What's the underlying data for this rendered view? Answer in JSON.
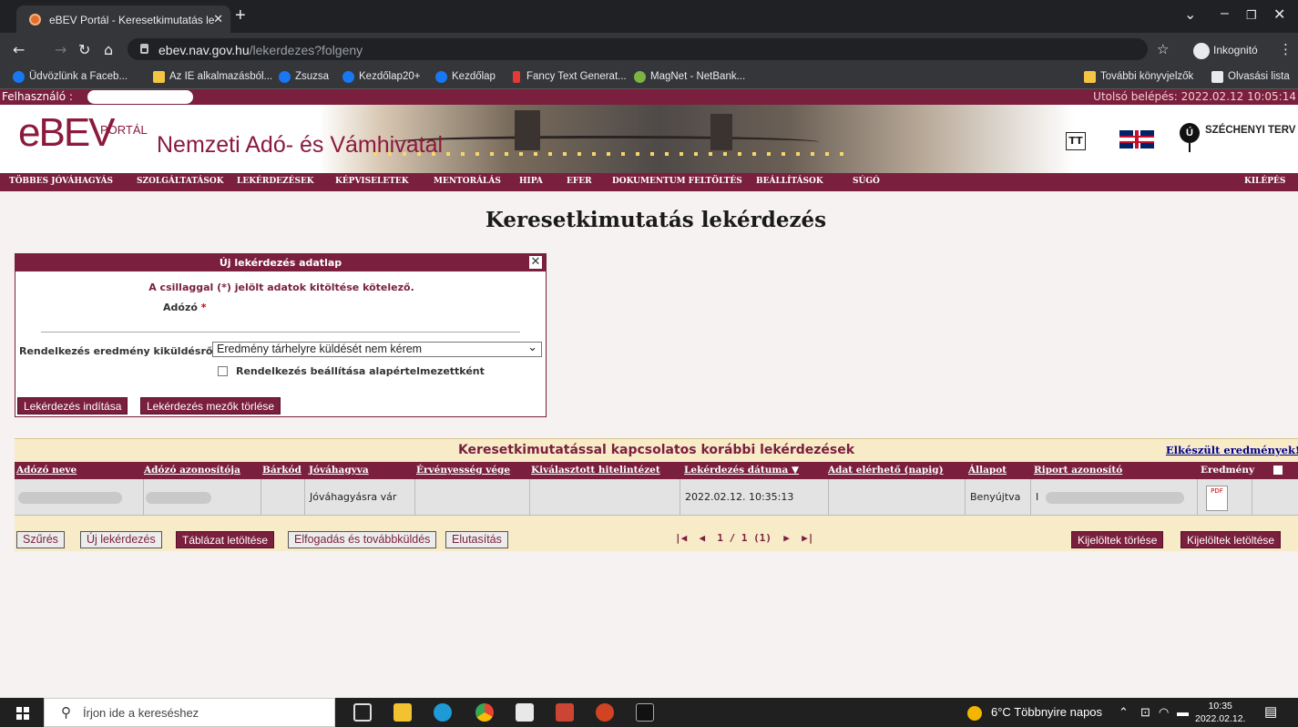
{
  "browser": {
    "tab_title": "eBEV Portál - Keresetkimutatás le",
    "url_host": "ebev.nav.gov.hu",
    "url_path": "/lekerdezes?folgeny",
    "incognito_label": "Inkognitó",
    "bookmarks": [
      "Üdvözlünk a Faceb...",
      "Az IE alkalmazásból...",
      "Zsuzsa",
      "Kezdőlap20+",
      "Kezdőlap",
      "Fancy Text Generat...",
      "MagNet - NetBank...",
      "További könyvjelzők",
      "Olvasási lista"
    ]
  },
  "site": {
    "user_label": "Felhasználó :",
    "last_login": "Utolsó belépés: 2022.02.12 10:05:14",
    "logo_ebev": "eBEV",
    "logo_portal": "PORTÁL",
    "logo_nav": "Nemzeti Adó- és Vámhivatal",
    "tt": "TT",
    "szechenyi": "SZÉCHENYI TERV",
    "szechenyi_glyph": "Ú",
    "menu": [
      "TÖBBES JÓVÁHAGYÁS",
      "SZOLGÁLTATÁSOK",
      "LEKÉRDEZÉSEK",
      "KÉPVISELETEK",
      "MENTORÁLÁS",
      "HIPA",
      "EFER",
      "DOKUMENTUM FELTÖLTÉS",
      "BEÁLLÍTÁSOK",
      "SÚGÓ"
    ],
    "logout": "KILÉPÉS",
    "page_title": "Keresetkimutatás lekérdezés"
  },
  "form": {
    "header": "Új lekérdezés adatlap",
    "required_note": "A csillaggal (*) jelölt adatok kitöltése kötelező.",
    "adozo_label": "Adózó",
    "star": "*",
    "rendelkezes_label": "Rendelkezés eredmény kiküldésről",
    "rendelkezes_value": "Eredmény tárhelyre küldését nem kérem",
    "default_checkbox_label": "Rendelkezés beállítása alapértelmezettként",
    "start_button": "Lekérdezés indítása",
    "clear_button": "Lekérdezés mezők törlése"
  },
  "table": {
    "title": "Keresetkimutatással kapcsolatos korábbi lekérdezések",
    "ready_link": "Elkészült eredmények!",
    "columns": [
      "Adózó neve",
      "Adózó azonosítója",
      "Bárkód",
      "Jóváhagyva",
      "Érvényesség vége",
      "Kiválasztott hitelintézet",
      "Lekérdezés dátuma ▼",
      "Adat elérhető (napig)",
      "Állapot",
      "Riport azonosító",
      "Eredmény"
    ],
    "row": {
      "jovahagyva": "Jóváhagyásra vár",
      "datum": "2022.02.12. 10:35:13",
      "allapot": "Benyújtva",
      "riport_prefix": "I",
      "pdf": "PDF"
    },
    "buttons": {
      "filter": "Szűrés",
      "new": "Új lekérdezés",
      "download_table": "Táblázat letöltése",
      "accept": "Elfogadás és továbbküldés",
      "reject": "Elutasítás",
      "delete_selected": "Kijelöltek törlése",
      "download_selected": "Kijelöltek letöltése"
    },
    "pager": "1 / 1 (1)"
  },
  "taskbar": {
    "search_placeholder": "Írjon ide a kereséshez",
    "weather": "6°C  Többnyire napos",
    "time": "10:35",
    "date": "2022.02.12."
  }
}
